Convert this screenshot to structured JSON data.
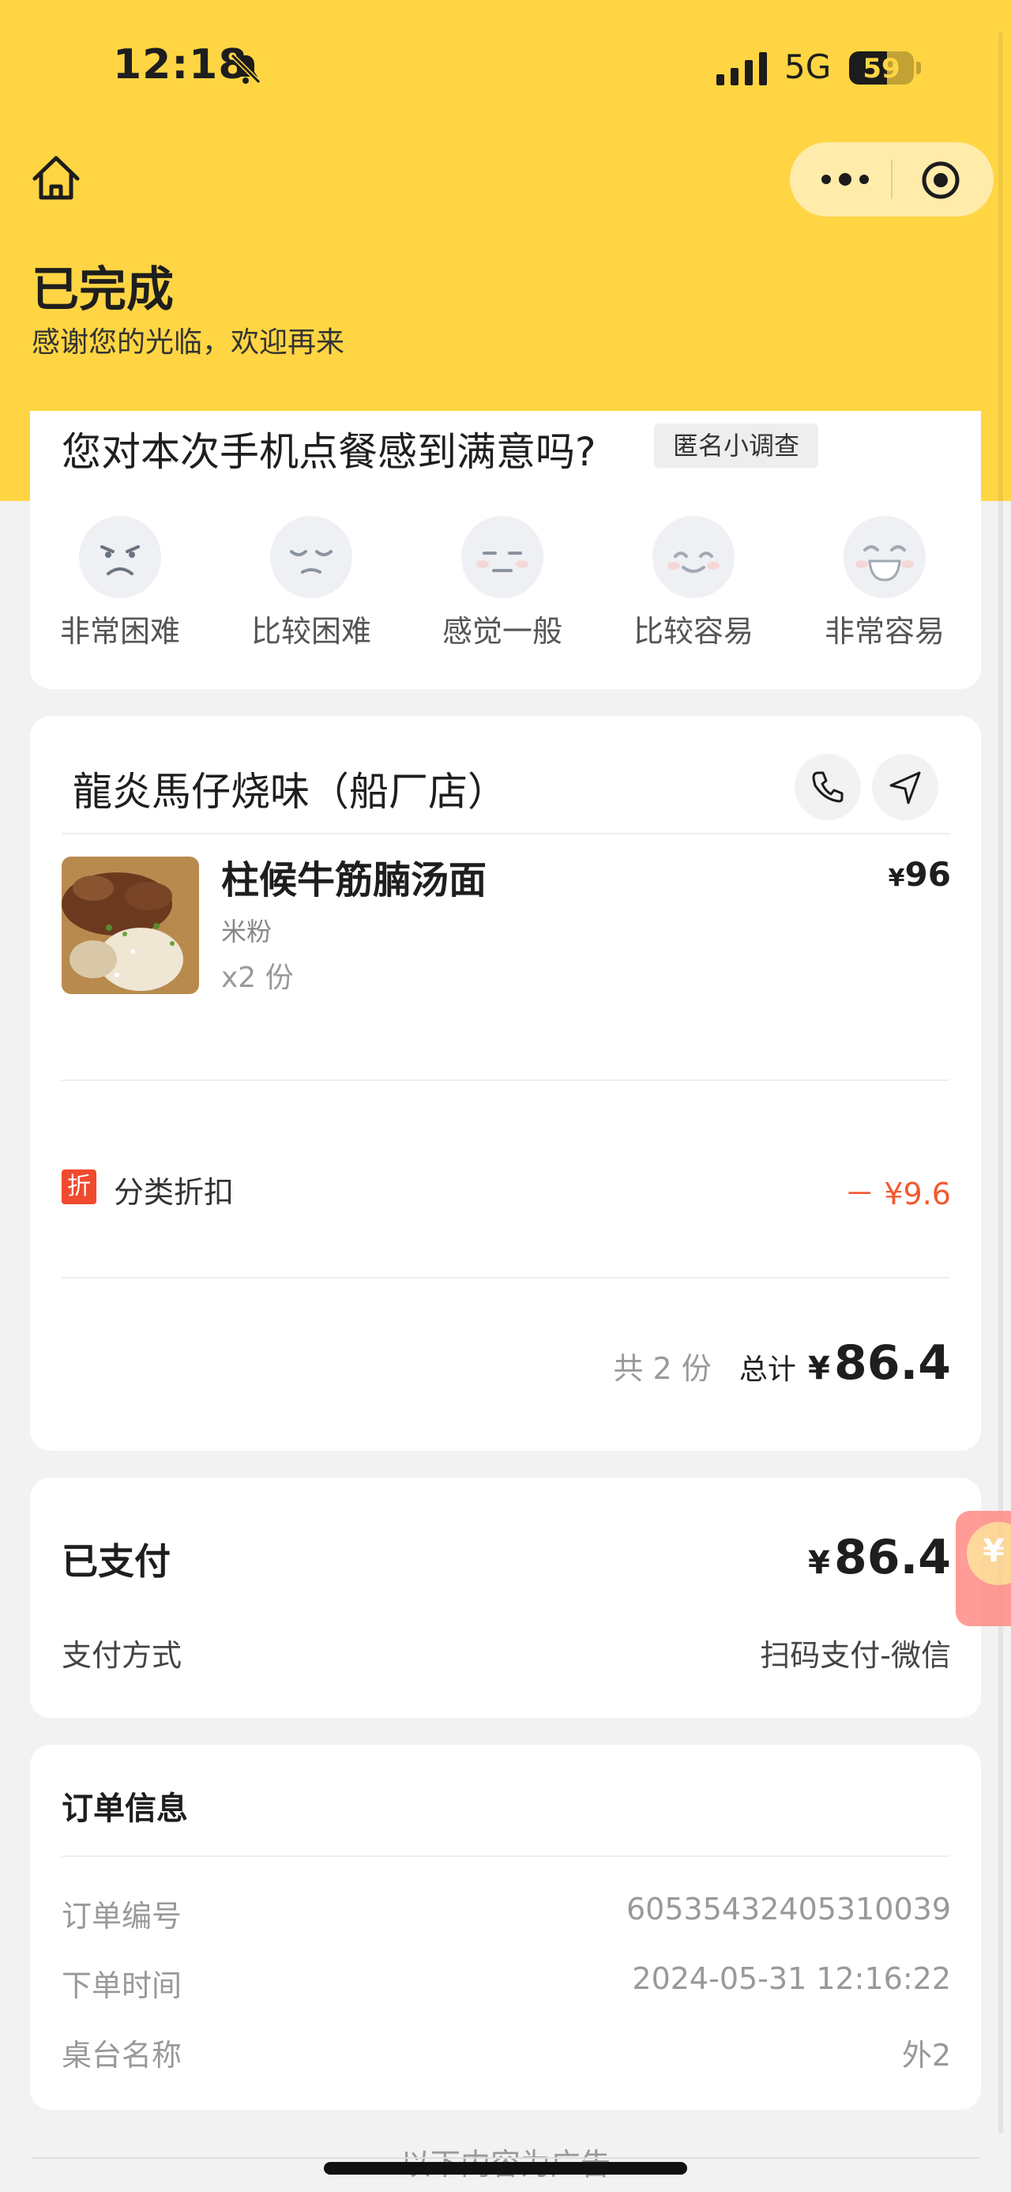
{
  "status_bar": {
    "time": "12:18",
    "network": "5G",
    "battery": "59",
    "battery_level": 0.59
  },
  "header": {
    "status_title": "已完成",
    "status_subtitle": "感谢您的光临，欢迎再来"
  },
  "survey": {
    "question": "您对本次手机点餐感到满意吗?",
    "tag": "匿名小调查",
    "options": [
      {
        "label": "非常困难",
        "icon": "very-unhappy-face-icon"
      },
      {
        "label": "比较困难",
        "icon": "unhappy-face-icon"
      },
      {
        "label": "感觉一般",
        "icon": "neutral-face-icon"
      },
      {
        "label": "比较容易",
        "icon": "smiling-face-icon"
      },
      {
        "label": "非常容易",
        "icon": "laughing-face-icon"
      }
    ]
  },
  "shop": {
    "name": "龍炎馬仔烧味（船厂店）",
    "dish": {
      "name": "柱候牛筋腩汤面",
      "spec": "米粉",
      "quantity": "x2 份",
      "currency": "¥",
      "price": "96"
    },
    "discount": {
      "badge": "折",
      "label": "分类折扣",
      "amount": "－ ¥9.6"
    },
    "summary": {
      "count": "共 2 份",
      "total_label": "总计",
      "currency": "¥",
      "total": "86.4"
    }
  },
  "payment": {
    "title": "已支付",
    "currency": "¥",
    "amount": "86.4",
    "method_label": "支付方式",
    "method_value": "扫码支付-微信"
  },
  "order_info": {
    "title": "订单信息",
    "rows": [
      {
        "label": "订单编号",
        "value": "60535432405310039"
      },
      {
        "label": "下单时间",
        "value": "2024-05-31 12:16:22"
      },
      {
        "label": "桌台名称",
        "value": "外2"
      }
    ]
  },
  "footer": {
    "ad_hint": "以下内容为广告"
  },
  "colors": {
    "brand_yellow": "#ffd543",
    "discount_red": "#f2582e",
    "badge_red": "#f04a2e"
  }
}
